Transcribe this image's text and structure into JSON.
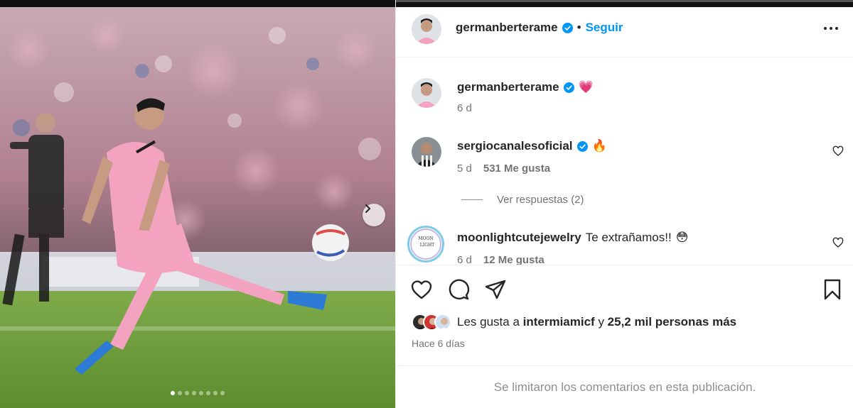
{
  "post": {
    "author": "germanberterame",
    "follow_label": "Seguir",
    "separator": "•",
    "more_label": "···",
    "carousel": {
      "slides_total": 8,
      "active_index": 0
    }
  },
  "caption": {
    "username": "germanberterame",
    "text": "",
    "emoji": "💗",
    "time": "6 d"
  },
  "comments": [
    {
      "username": "sergiocanalesoficial",
      "verified": true,
      "text": "",
      "emoji": "🔥",
      "time": "5 d",
      "likes": "531 Me gusta"
    },
    {
      "username": "moonlightcutejewelry",
      "verified": false,
      "text": "Te extrañamos!!",
      "emoji": "😳",
      "time": "6 d",
      "likes": "12 Me gusta"
    }
  ],
  "replies_label": "Ver respuestas (2)",
  "likes_summary": {
    "prefix": "Les gusta a ",
    "account": "intermiamicf",
    "middle": " y ",
    "count": "25,2 mil personas más"
  },
  "time_ago": "Hace 6 días",
  "comments_limited": "Se limitaron los comentarios en esta publicación.",
  "avatar_logo_text": {
    "line1": "MOON",
    "line2": "LIGHT"
  },
  "colors": {
    "accent": "#0095f6",
    "verified": "#0095f6",
    "jersey": "#f3a3c0",
    "pitch": "#6a9a3a"
  }
}
